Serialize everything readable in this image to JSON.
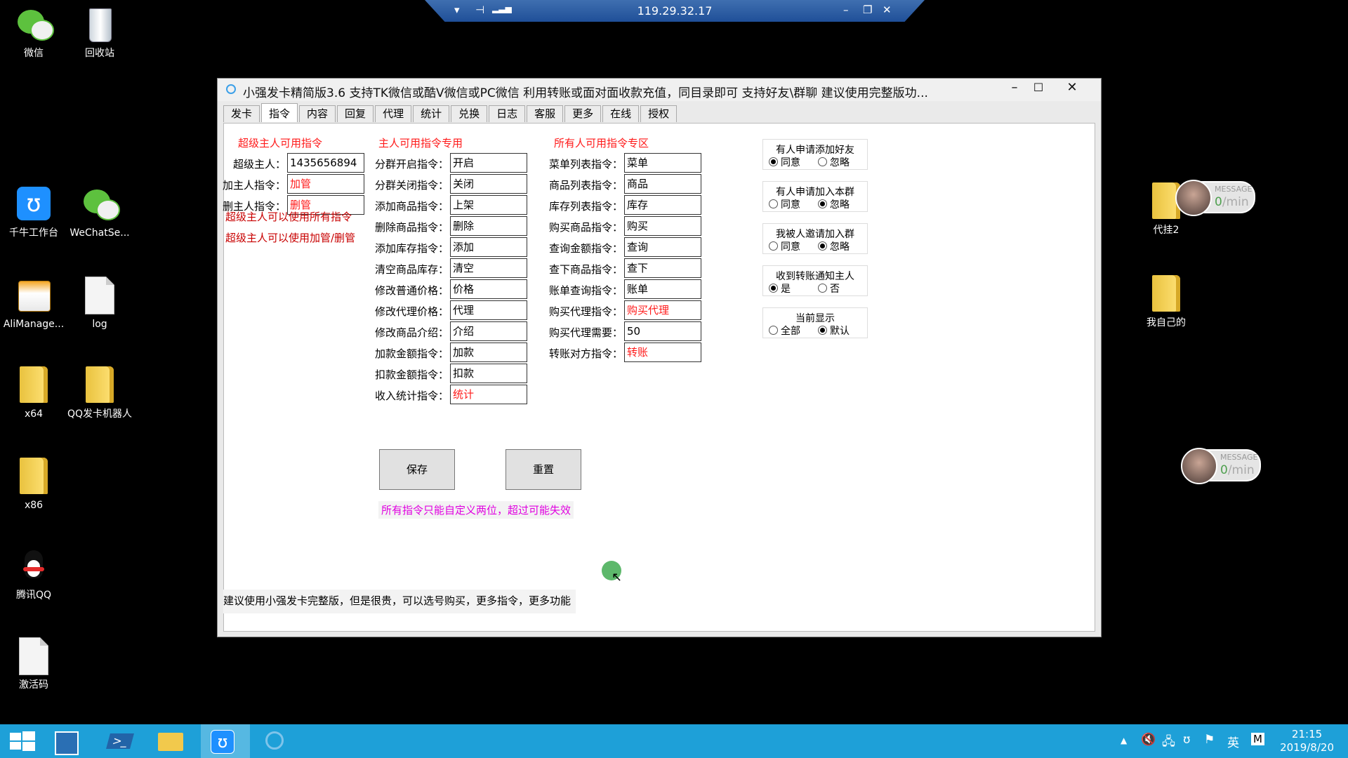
{
  "remote_bar": {
    "ip": "119.29.32.17"
  },
  "desktop_icons_left": [
    {
      "label": "微信",
      "type": "wechat"
    },
    {
      "label": "回收站",
      "type": "recycle"
    },
    {
      "label": "千牛工作台",
      "type": "qianniu"
    },
    {
      "label": "WeChatSe...",
      "type": "wechat"
    },
    {
      "label": "AliManage...",
      "type": "box"
    },
    {
      "label": "log",
      "type": "file"
    },
    {
      "label": "x64",
      "type": "folder"
    },
    {
      "label": "QQ发卡机器人",
      "type": "folder"
    },
    {
      "label": "x86",
      "type": "folder"
    },
    {
      "label": "腾讯QQ",
      "type": "qq"
    },
    {
      "label": "激活码",
      "type": "file"
    }
  ],
  "desktop_icons_right": [
    {
      "label": "代挂2"
    },
    {
      "label": "我自己的"
    }
  ],
  "message_widgets": [
    {
      "title": "MESSAGE",
      "count": "0",
      "unit": "/min"
    },
    {
      "title": "MESSAGE",
      "count": "0",
      "unit": "/min"
    }
  ],
  "window": {
    "title": "小强发卡精简版3.6    支持TK微信或酷V微信或PC微信  利用转账或面对面收款充值，同目录即可    支持好友\\群聊    建议使用完整版功...",
    "tabs": [
      "发卡",
      "指令",
      "内容",
      "回复",
      "代理",
      "统计",
      "兑换",
      "日志",
      "客服",
      "更多",
      "在线",
      "授权"
    ],
    "active_tab": "指令",
    "super_master": {
      "header": "超级主人可用指令",
      "rows": [
        {
          "label": "超级主人：",
          "value": "1435656894",
          "red": false
        },
        {
          "label": "加主人指令：",
          "value": "加管",
          "red": true
        },
        {
          "label": "删主人指令：",
          "value": "删管",
          "red": true
        }
      ],
      "note1": "超级主人可以使用所有指令",
      "note2": "超级主人可以使用加管/删管"
    },
    "master": {
      "header": "主人可用指令专用",
      "rows": [
        {
          "label": "分群开启指令：",
          "value": "开启",
          "red": false
        },
        {
          "label": "分群关闭指令：",
          "value": "关闭",
          "red": false
        },
        {
          "label": "添加商品指令：",
          "value": "上架",
          "red": false
        },
        {
          "label": "删除商品指令：",
          "value": "删除",
          "red": false
        },
        {
          "label": "添加库存指令：",
          "value": "添加",
          "red": false
        },
        {
          "label": "清空商品库存：",
          "value": "清空",
          "red": false
        },
        {
          "label": "修改普通价格：",
          "value": "价格",
          "red": false
        },
        {
          "label": "修改代理价格：",
          "value": "代理",
          "red": false
        },
        {
          "label": "修改商品介绍：",
          "value": "介绍",
          "red": false
        },
        {
          "label": "加款金额指令：",
          "value": "加款",
          "red": false
        },
        {
          "label": "扣款金额指令：",
          "value": "扣款",
          "red": false
        },
        {
          "label": "收入统计指令：",
          "value": "统计",
          "red": true
        }
      ]
    },
    "everyone": {
      "header": "所有人可用指令专区",
      "rows": [
        {
          "label": "菜单列表指令：",
          "value": "菜单",
          "red": false
        },
        {
          "label": "商品列表指令：",
          "value": "商品",
          "red": false
        },
        {
          "label": "库存列表指令：",
          "value": "库存",
          "red": false
        },
        {
          "label": "购买商品指令：",
          "value": "购买",
          "red": false
        },
        {
          "label": "查询金额指令：",
          "value": "查询",
          "red": false
        },
        {
          "label": "查下商品指令：",
          "value": "查下",
          "red": false
        },
        {
          "label": "账单查询指令：",
          "value": "账单",
          "red": false
        },
        {
          "label": "购买代理指令：",
          "value": "购买代理",
          "red": true
        },
        {
          "label": "购买代理需要：",
          "value": "50",
          "red": false
        },
        {
          "label": "转账对方指令：",
          "value": "转账",
          "red": true
        }
      ]
    },
    "option_groups": [
      {
        "title": "有人申请添加好友",
        "options": [
          "同意",
          "忽略"
        ],
        "selected": 0
      },
      {
        "title": "有人申请加入本群",
        "options": [
          "同意",
          "忽略"
        ],
        "selected": 1
      },
      {
        "title": "我被人邀请加入群",
        "options": [
          "同意",
          "忽略"
        ],
        "selected": 1
      },
      {
        "title": "收到转账通知主人",
        "options": [
          "是",
          "否"
        ],
        "selected": 0
      },
      {
        "title": "当前显示",
        "options": [
          "全部",
          "默认"
        ],
        "selected": 1
      }
    ],
    "save_label": "保存",
    "reset_label": "重置",
    "warning": "所有指令只能自定义两位，超过可能失效",
    "footer": "建议使用小强发卡完整版，但是很贵，可以选号购买，更多指令，更多功能"
  },
  "taskbar": {
    "time": "21:15",
    "date": "2019/8/20",
    "ime": "英",
    "ime2": "M"
  }
}
